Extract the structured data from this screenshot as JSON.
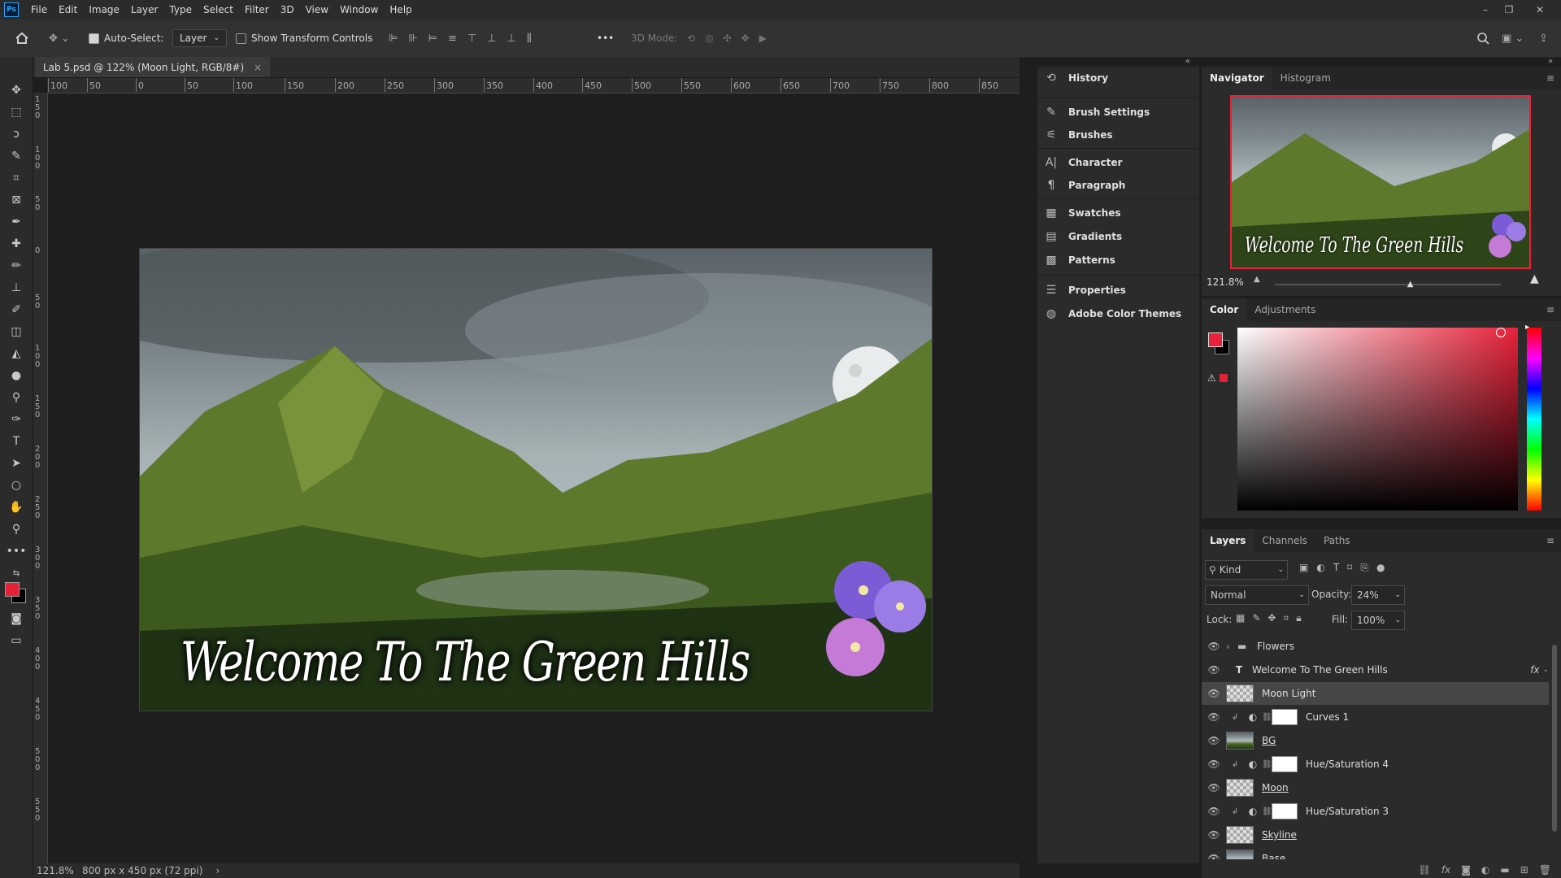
{
  "app": {
    "logo": "Ps"
  },
  "menu": [
    "File",
    "Edit",
    "Image",
    "Layer",
    "Type",
    "Select",
    "Filter",
    "3D",
    "View",
    "Window",
    "Help"
  ],
  "options_bar": {
    "auto_select_label": "Auto-Select:",
    "auto_select_value": "Layer",
    "show_transform_label": "Show Transform Controls",
    "mode_3d_label": "3D Mode:",
    "more": "•••"
  },
  "document": {
    "tab_title": "Lab 5.psd @ 122% (Moon Light, RGB/8#)",
    "close": "×",
    "ruler_top": [
      "100",
      "50",
      "0",
      "50",
      "100",
      "150",
      "200",
      "250",
      "300",
      "350",
      "400",
      "450",
      "500",
      "550",
      "600",
      "650",
      "700",
      "750",
      "800",
      "850"
    ],
    "ruler_left": [
      "150",
      "100",
      "50",
      "0",
      "50",
      "100",
      "150",
      "200",
      "250",
      "300",
      "350",
      "400",
      "450",
      "500",
      "550"
    ],
    "canvas_text": "Welcome To The Green Hills",
    "zoom": "121.8%",
    "doc_info": "800 px x 450 px (72 ppi)",
    "status_arrow": "›"
  },
  "mid_panel": {
    "items": [
      {
        "label": "History",
        "icon": "history-icon"
      },
      {
        "label": "Brush Settings",
        "icon": "brush-settings-icon"
      },
      {
        "label": "Brushes",
        "icon": "brushes-icon"
      },
      {
        "label": "Character",
        "icon": "character-icon"
      },
      {
        "label": "Paragraph",
        "icon": "paragraph-icon"
      },
      {
        "label": "Swatches",
        "icon": "swatches-icon"
      },
      {
        "label": "Gradients",
        "icon": "gradients-icon"
      },
      {
        "label": "Patterns",
        "icon": "patterns-icon"
      },
      {
        "label": "Properties",
        "icon": "properties-icon"
      },
      {
        "label": "Adobe Color Themes",
        "icon": "adobe-color-themes-icon"
      }
    ]
  },
  "navigator": {
    "tabs": [
      "Navigator",
      "Histogram"
    ],
    "zoom": "121.8%",
    "preview_text": "Welcome To The Green Hills",
    "zoom_level": 0.6
  },
  "color_panel": {
    "tabs": [
      "Color",
      "Adjustments"
    ],
    "foreground": "#e8213a",
    "background": "#000000"
  },
  "layers_panel": {
    "tabs": [
      "Layers",
      "Channels",
      "Paths"
    ],
    "filter_kind": "Kind",
    "blend_mode": "Normal",
    "opacity_label": "Opacity:",
    "opacity_value": "24%",
    "lock_label": "Lock:",
    "fill_label": "Fill:",
    "fill_value": "100%",
    "layers": [
      {
        "name": "Flowers",
        "type": "group"
      },
      {
        "name": "Welcome To The Green Hills",
        "type": "text",
        "fx": "fx"
      },
      {
        "name": "Moon Light",
        "type": "pixel",
        "selected": true
      },
      {
        "name": "Curves 1",
        "type": "adjustment"
      },
      {
        "name": "BG",
        "type": "pixel"
      },
      {
        "name": "Hue/Saturation 4",
        "type": "adjustment"
      },
      {
        "name": "Moon",
        "type": "pixel"
      },
      {
        "name": "Hue/Saturation 3",
        "type": "adjustment"
      },
      {
        "name": "Skyline",
        "type": "pixel"
      },
      {
        "name": "Base",
        "type": "pixel"
      }
    ]
  }
}
